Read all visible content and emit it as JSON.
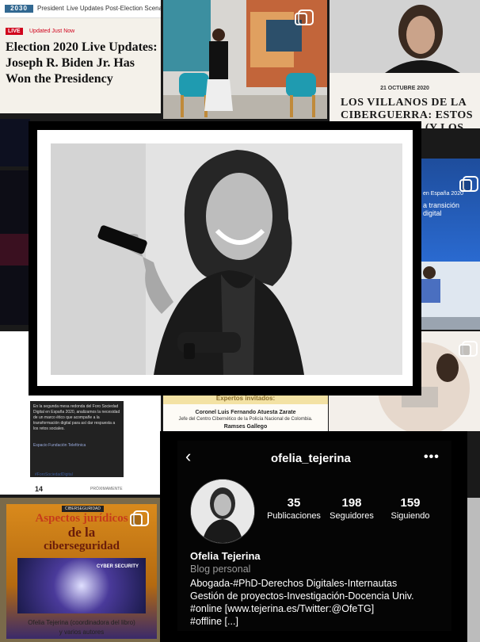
{
  "news": {
    "logo": "2030",
    "nav": [
      "President",
      "Live Updates",
      "Post-Election Scenarios"
    ],
    "live_badge": "LIVE",
    "updated": "Updated Just Now",
    "headline": "Election 2020 Live Updates: Joseph R. Biden Jr. Has Won the Presidency"
  },
  "article": {
    "date": "21 OCTUBRE 2020",
    "title": "LOS VILLANOS DE LA CIBERGUERRA: ESTOS PAÍSES QUE ... (Y LOS ... QUE LES"
  },
  "digital_banner": {
    "line1": "en España 2020",
    "line2": "a transición digital"
  },
  "forum_post": {
    "text": "En la segunda mesa redonda del Foro Sociedad Digital en España 2020, analizamos la necesidad de un marco ético que acompañe a la transformación digital para así dar respuesta a los retos sociales.",
    "location": "Espacio Fundación Telefónica",
    "hashtag": "#ForoSociedadDigital",
    "date_day": "14",
    "upcoming": "PRÓXIMAMENTE"
  },
  "experts": {
    "heading": "Expertos invitados:",
    "expert1_name": "Coronel Luis Fernando Atuesta Zarate",
    "expert1_role": "Jefe del Centro Cibernético de la Policía Nacional de Colombia.",
    "expert2_name": "Ramses Gallego"
  },
  "book": {
    "badge": "CIBERSEGURIDAD",
    "title_line1": "Aspectos jurídicos",
    "title_line2": "de la",
    "title_line3": "ciberseguridad",
    "art_label": "CYBER SECURITY",
    "author": "Ofelia Tejerina (coordinadora del libro)",
    "author2": "y varios autores"
  },
  "profile": {
    "username": "ofelia_tejerina",
    "back_icon": "chevron-left-icon",
    "menu_icon": "more-options-icon",
    "stats": [
      {
        "value": "35",
        "label": "Publicaciones"
      },
      {
        "value": "198",
        "label": "Seguidores"
      },
      {
        "value": "159",
        "label": "Siguiendo"
      }
    ],
    "name": "Ofelia Tejerina",
    "category": "Blog personal",
    "bio_lines": [
      "Abogada-#PhD-Derechos Digitales-Internautas",
      "Gestión de proyectos-Investigación-Docencia Univ.",
      "#online [www.tejerina.es/Twitter:@OfeTG]",
      "#offline [...]"
    ]
  },
  "colors": {
    "live_red": "#d0021b",
    "news_blue": "#326891",
    "profile_bg": "#000000",
    "muted_text": "#9a9a9a"
  }
}
